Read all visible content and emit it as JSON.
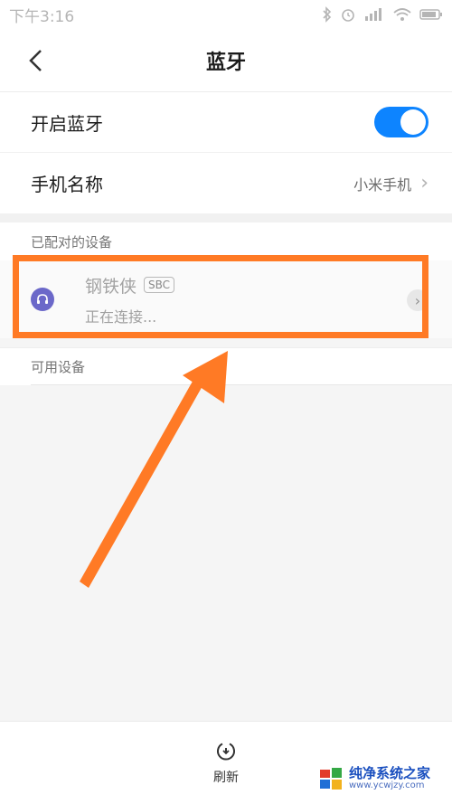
{
  "status_bar": {
    "time": "下午3:16",
    "icons": [
      "bluetooth-icon",
      "alarm-icon",
      "hd-signal-icon",
      "wifi-icon",
      "battery-icon"
    ]
  },
  "header": {
    "title": "蓝牙"
  },
  "settings": {
    "bluetooth_label": "开启蓝牙",
    "bluetooth_on": true,
    "phone_name_label": "手机名称",
    "phone_name_value": "小米手机"
  },
  "paired": {
    "header": "已配对的设备",
    "device_name": "钢铁侠",
    "codec": "SBC",
    "status": "正在连接..."
  },
  "available": {
    "header": "可用设备"
  },
  "bottom": {
    "refresh_label": "刷新"
  },
  "watermark": {
    "title": "纯净系统之家",
    "subtitle": "www.ycwjzy.com"
  },
  "colors": {
    "accent": "#0d84ff",
    "highlight": "#ff7a25",
    "device_icon": "#6b68c9"
  }
}
